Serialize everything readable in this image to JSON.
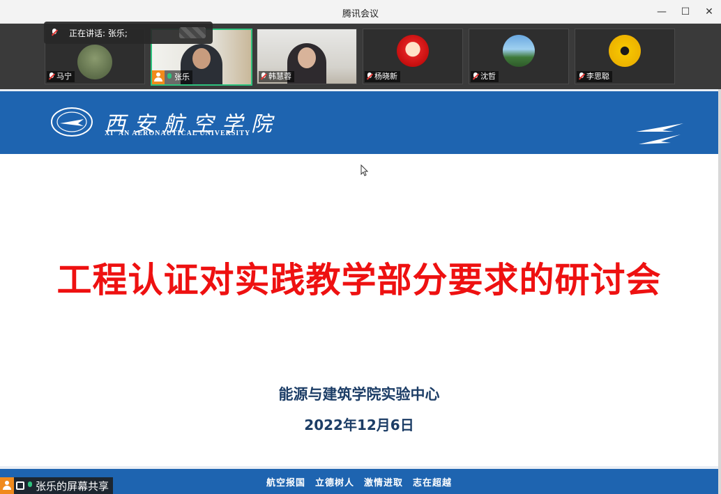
{
  "window": {
    "title": "腾讯会议",
    "minimize_glyph": "—",
    "maximize_glyph": "☐",
    "close_glyph": "✕"
  },
  "speaking": {
    "label": "正在讲话: 张乐;"
  },
  "participants": [
    {
      "name": "马宁",
      "mic": "muted"
    },
    {
      "name": "张乐",
      "mic": "on",
      "active": true
    },
    {
      "name": "韩慧蓉",
      "mic": "muted"
    },
    {
      "name": "杨晓新",
      "mic": "muted"
    },
    {
      "name": "沈哲",
      "mic": "muted"
    },
    {
      "name": "李思聪",
      "mic": "muted"
    }
  ],
  "slide": {
    "university_cn": "西安航空学院",
    "university_en": "XI' AN AERONAUTICAL UNIVERSITY",
    "title": "工程认证对实践教学部分要求的研讨会",
    "subtitle": "能源与建筑学院实验中心",
    "date": "2022年12月6日",
    "slogan": "航空报国　立德树人　激情进取　志在超越"
  },
  "share_bar": {
    "label": "张乐的屏幕共享"
  },
  "colors": {
    "accent_blue": "#1e64b0",
    "title_red": "#ee1111",
    "active_green": "#2ec27e"
  }
}
